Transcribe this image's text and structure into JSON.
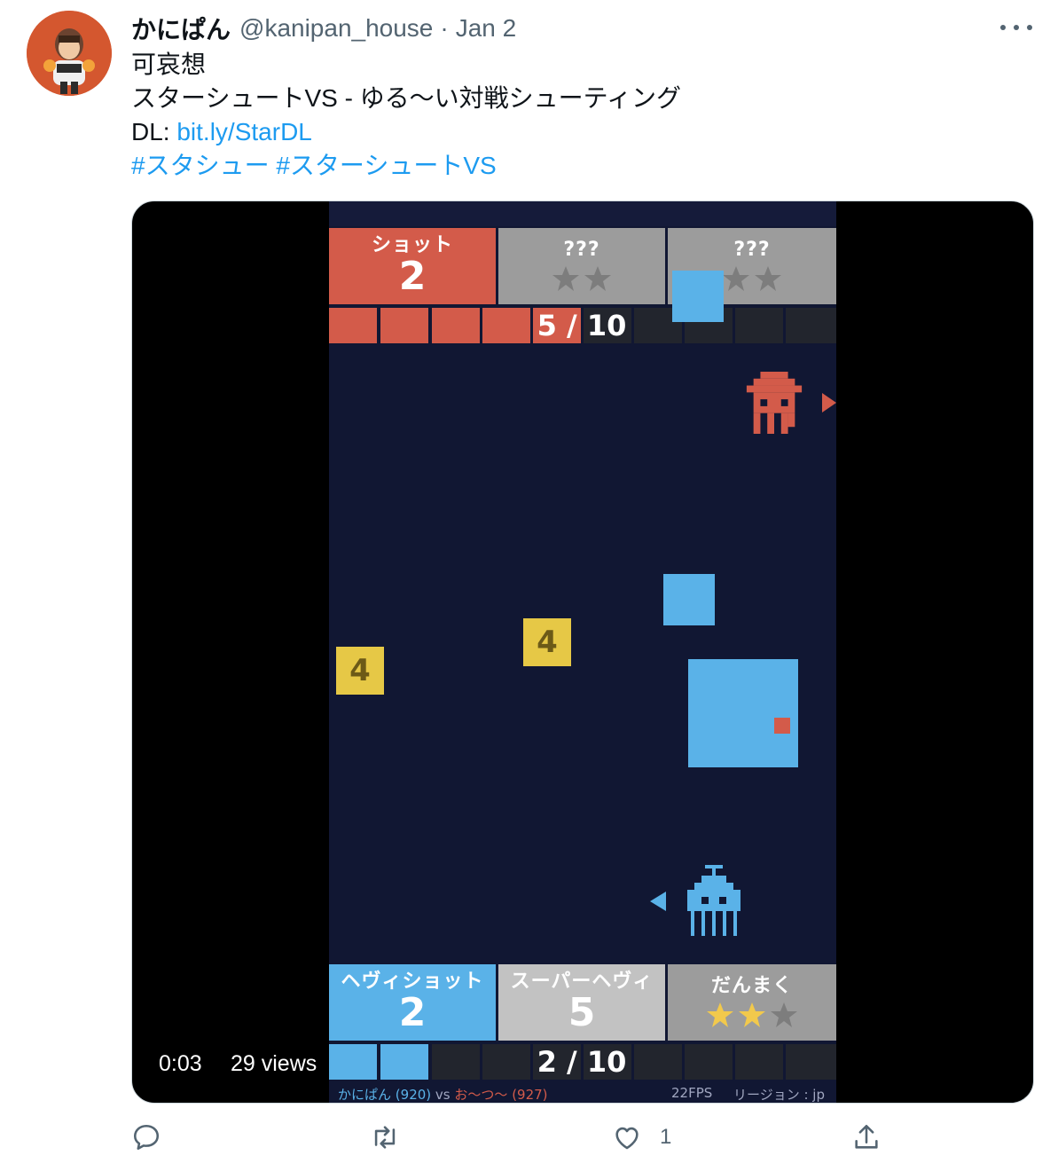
{
  "tweet": {
    "display_name": "かにぱん",
    "handle": "@kanipan_house",
    "separator": "·",
    "date": "Jan 2",
    "lines": {
      "line1": "可哀想",
      "line2": "スターシュートVS - ゆる〜い対戦シューティング",
      "dl_prefix": "DL: ",
      "dl_link": "bit.ly/StarDL",
      "hashtag1": "#スタシュー",
      "hashtag2": "#スターシュートVS"
    }
  },
  "video": {
    "time": "0:03",
    "views": "29 views"
  },
  "game": {
    "top_cards": [
      {
        "label": "ショット",
        "value": "2"
      },
      {
        "label": "???",
        "value": ""
      },
      {
        "label": "???",
        "value": ""
      }
    ],
    "top_counter": "5 / 10",
    "top_progress": 0.5,
    "field_boxes": [
      "4",
      "4"
    ],
    "bottom_cards": [
      {
        "label": "ヘヴィショット",
        "value": "2"
      },
      {
        "label": "スーパーヘヴィ",
        "value": "5"
      },
      {
        "label": "だんまく",
        "value": ""
      }
    ],
    "bottom_counter": "2 / 10",
    "bottom_progress": 0.2,
    "player1": "かにぱん",
    "player1_rating": "(920)",
    "vs": "vs",
    "player2": "お〜つ〜",
    "player2_rating": "(927)",
    "fps": "22FPS",
    "region": "リージョン : jp",
    "colors": {
      "red": "#d35b4a",
      "blue": "#5ab2e8",
      "bg": "#111733",
      "yellow": "#e6c846"
    }
  },
  "actions": {
    "reply_icon": "reply-icon",
    "retweet_icon": "retweet-icon",
    "like_icon": "heart-icon",
    "like_count": "1",
    "share_icon": "share-icon"
  }
}
